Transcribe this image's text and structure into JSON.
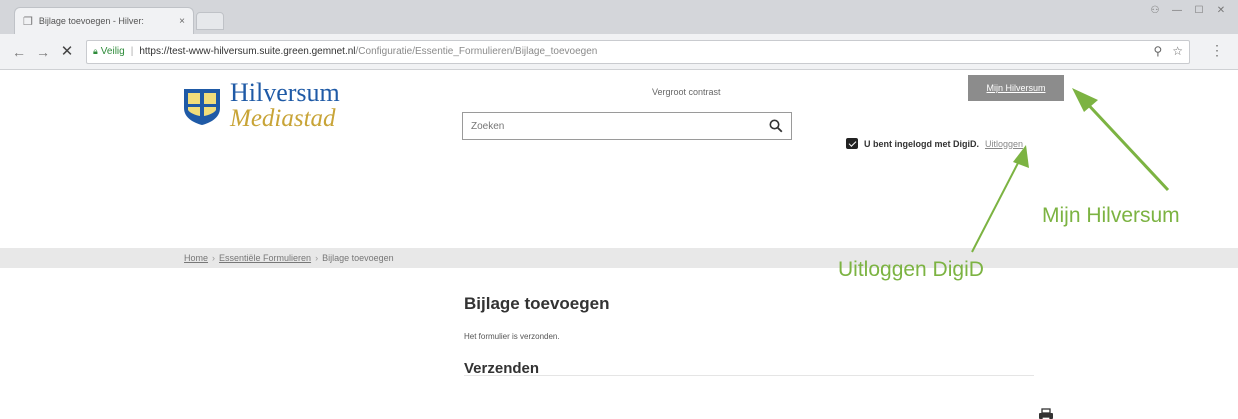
{
  "browser": {
    "tab_title": "Bijlage toevoegen - Hilver:",
    "tab_close": "×",
    "secure_label": "Veilig",
    "url_host": "https://test-www-hilversum.suite.green.gemnet.nl",
    "url_path": "/Configuratie/Essentie_Formulieren/Bijlage_toevoegen"
  },
  "header": {
    "logo_line1": "Hilversum",
    "logo_line2": "Mediastad",
    "contrast_link": "Vergroot contrast",
    "search_placeholder": "Zoeken",
    "mijn_button": "Mijn Hilversum",
    "login_text": "U bent ingelogd met DigiD.",
    "logout_link": "Uitloggen"
  },
  "breadcrumb": {
    "items": [
      "Home",
      "Essentiële Formulieren",
      "Bijlage toevoegen"
    ],
    "separator": "›"
  },
  "main": {
    "title": "Bijlage toevoegen",
    "message": "Het formulier is verzonden.",
    "section_title": "Verzenden"
  },
  "annotations": {
    "mijn": "Mijn Hilversum",
    "uitloggen": "Uitloggen DigiD",
    "color": "#7cb342"
  }
}
